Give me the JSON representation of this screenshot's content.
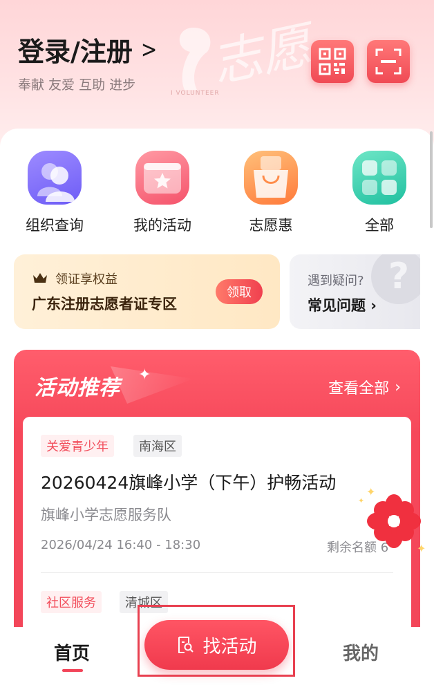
{
  "header": {
    "login_title": "登录/注册",
    "slogan": "奉献 友爱 互助 进步",
    "watermark_text": "志愿",
    "watermark_sub": "I VOLUNTEER",
    "qr_icon": "qr-code-icon",
    "scan_icon": "scan-icon",
    "accent_color": "#f04a55"
  },
  "quick_menu": [
    {
      "label": "组织查询",
      "icon": "people-icon"
    },
    {
      "label": "我的活动",
      "icon": "star-card-icon"
    },
    {
      "label": "志愿惠",
      "icon": "shopping-bag-icon"
    },
    {
      "label": "全部",
      "icon": "grid-icon"
    }
  ],
  "promo": {
    "left_sub": "领证享权益",
    "left_main": "广东注册志愿者证专区",
    "claim_label": "领取",
    "right_sub": "遇到疑问?",
    "right_main": "常见问题"
  },
  "recommend": {
    "title": "活动推荐",
    "view_all": "查看全部",
    "activities": [
      {
        "tags": [
          "关爱青少年",
          "南海区"
        ],
        "title": "20260424旗峰小学（下午）护畅活动",
        "org": "旗峰小学志愿服务队",
        "time": "2026/04/24 16:40 - 18:30",
        "remain": "剩余名额 6"
      },
      {
        "tags": [
          "社区服务",
          "清城区"
        ]
      }
    ]
  },
  "bottom_nav": {
    "home": "首页",
    "find": "找活动",
    "mine": "我的"
  }
}
